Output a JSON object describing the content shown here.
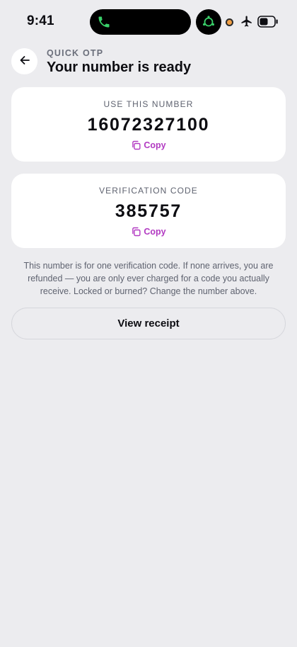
{
  "status_bar": {
    "time": "9:41",
    "icons": [
      "phone-call-icon",
      "camera-icon",
      "recording-dot-icon",
      "airplane-icon",
      "battery-icon"
    ],
    "recording_color": "#f2a045",
    "call_color": "#3ad16a"
  },
  "header": {
    "eyebrow": "QUICK OTP",
    "title": "Your number is ready",
    "back_icon": "arrow-left-icon"
  },
  "number_card": {
    "label": "USE THIS NUMBER",
    "value": "16072327100",
    "copy_label": "Copy"
  },
  "code_card": {
    "label": "VERIFICATION CODE",
    "value": "385757",
    "copy_label": "Copy"
  },
  "note": "This number is for one verification code. If none arrives, you are refunded — you are only ever charged for a code you actually receive. Locked or burned? Change the number above.",
  "actions": {
    "view_receipt": "View receipt"
  },
  "colors": {
    "background": "#ececef",
    "card": "#ffffff",
    "accent": "#b23ac2",
    "muted_text": "#5f6370"
  }
}
